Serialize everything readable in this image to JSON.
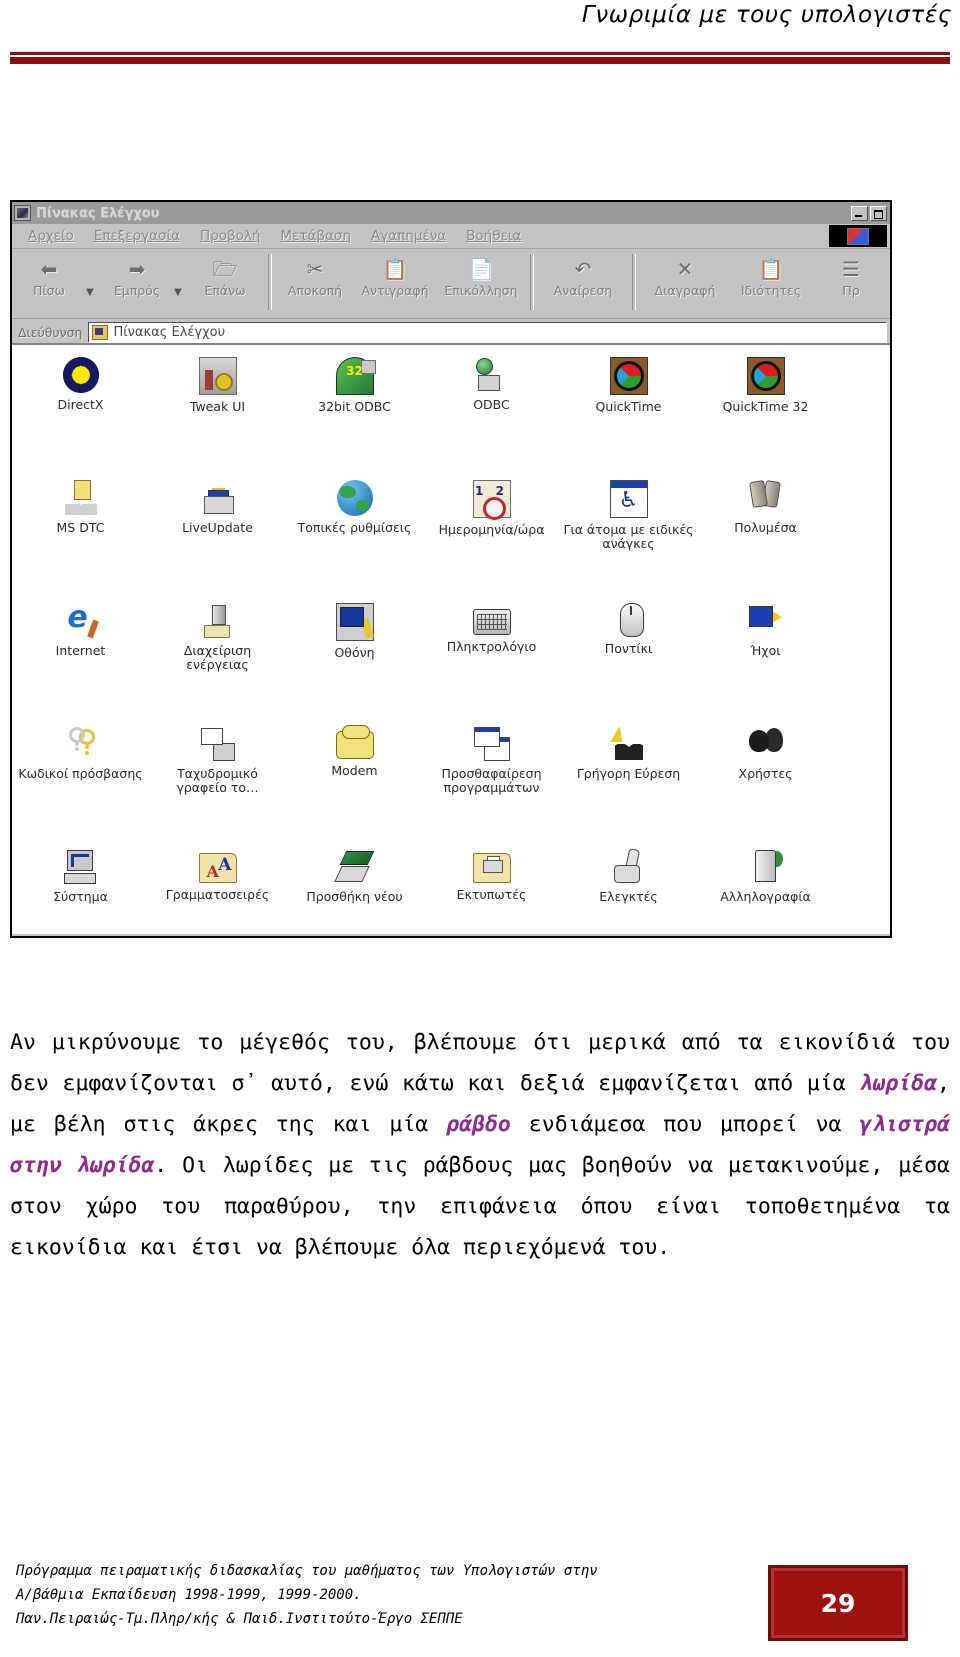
{
  "header": {
    "title": "Γνωριμία με τους υπολογιστές"
  },
  "window": {
    "title": "Πίνακας Ελέγχου",
    "title_icon": "control-panel-icon",
    "buttons": {
      "minimize": "minimize-icon",
      "maximize": "maximize-icon"
    },
    "menu": [
      {
        "label": "Αρχείο"
      },
      {
        "label": "Επεξεργασία"
      },
      {
        "label": "Προβολή"
      },
      {
        "label": "Μετάβαση"
      },
      {
        "label": "Αγαπημένα"
      },
      {
        "label": "Βοήθεια"
      }
    ],
    "toolbar": [
      {
        "label": "Πίσω",
        "icon": "back-arrow-icon"
      },
      {
        "label": "Εμπρός",
        "icon": "forward-arrow-icon"
      },
      {
        "label": "Επάνω",
        "icon": "up-folder-icon"
      },
      {
        "label": "Αποκοπή",
        "icon": "scissors-icon"
      },
      {
        "label": "Αντιγραφή",
        "icon": "copy-icon"
      },
      {
        "label": "Επικόλληση",
        "icon": "paste-icon"
      },
      {
        "label": "Αναίρεση",
        "icon": "undo-icon"
      },
      {
        "label": "Διαγραφή",
        "icon": "delete-x-icon"
      },
      {
        "label": "Ιδιότητες",
        "icon": "properties-icon"
      },
      {
        "label": "Πρ",
        "icon": "views-icon"
      }
    ],
    "address": {
      "label": "Διεύθυνση",
      "value": "Πίνακας Ελέγχου",
      "icon": "control-panel-folder-icon"
    },
    "items": [
      {
        "label": "DirectX",
        "icon": "directx-icon"
      },
      {
        "label": "Tweak UI",
        "icon": "tweak-ui-icon"
      },
      {
        "label": "32bit ODBC",
        "icon": "odbc32-icon"
      },
      {
        "label": "ODBC",
        "icon": "odbc-icon"
      },
      {
        "label": "QuickTime",
        "icon": "quicktime-icon"
      },
      {
        "label": "QuickTime 32",
        "icon": "quicktime32-icon"
      },
      {
        "label": "MS DTC",
        "icon": "msdtc-icon"
      },
      {
        "label": "LiveUpdate",
        "icon": "liveupdate-icon"
      },
      {
        "label": "Τοπικές ρυθμίσεις",
        "icon": "regional-settings-icon"
      },
      {
        "label": "Ημερομηνία/ώρα",
        "icon": "date-time-icon"
      },
      {
        "label": "Για άτομα με ειδικές ανάγκες",
        "icon": "accessibility-icon"
      },
      {
        "label": "Πολυμέσα",
        "icon": "multimedia-icon"
      },
      {
        "label": "Internet",
        "icon": "internet-icon"
      },
      {
        "label": "Διαχείριση ενέργειας",
        "icon": "power-management-icon"
      },
      {
        "label": "Οθόνη",
        "icon": "display-icon"
      },
      {
        "label": "Πληκτρολόγιο",
        "icon": "keyboard-icon"
      },
      {
        "label": "Ποντίκι",
        "icon": "mouse-icon"
      },
      {
        "label": "Ήχοι",
        "icon": "sounds-icon"
      },
      {
        "label": "Κωδικοί πρόσβασης",
        "icon": "passwords-icon"
      },
      {
        "label": "Ταχυδρομικό γραφείο το…",
        "icon": "mail-postoffice-icon"
      },
      {
        "label": "Modem",
        "icon": "modem-icon"
      },
      {
        "label": "Προσθαφαίρεση προγραμμάτων",
        "icon": "add-remove-programs-icon"
      },
      {
        "label": "Γρήγορη Εύρεση",
        "icon": "fast-find-icon"
      },
      {
        "label": "Χρήστες",
        "icon": "users-icon"
      },
      {
        "label": "Σύστημα",
        "icon": "system-icon"
      },
      {
        "label": "Γραμματοσειρές",
        "icon": "fonts-folder-icon"
      },
      {
        "label": "Προσθήκη νέου",
        "icon": "add-new-hardware-icon"
      },
      {
        "label": "Εκτυπωτές",
        "icon": "printers-folder-icon"
      },
      {
        "label": "Ελεγκτές",
        "icon": "game-controllers-icon"
      },
      {
        "label": "Αλληλογραφία",
        "icon": "mail-icon"
      }
    ]
  },
  "body": {
    "part1": "Αν μικρύνουμε το μέγεθός του, βλέπουμε ότι μερικά από τα εικονίδιά του δεν εμφανίζονται σ᾽ αυτό, ενώ κάτω και δεξιά εμφανίζεται από μία ",
    "term1": "λωρίδα",
    "part2": ", με βέλη στις άκρες της και μία ",
    "term2": "ράβδο",
    "part3": " ενδιάμεσα που μπορεί να ",
    "term3": "γλιστρά στην λωρίδα",
    "part4": ". Οι λωρίδες με τις ράβδους μας βοηθούν να μετακινούμε, μέσα στον χώρο του παραθύρου, την επιφάνεια όπου είναι τοποθετημένα τα εικονίδια και έτσι να βλέπουμε όλα περιεχόμενά του."
  },
  "footer": {
    "line1": "Πρόγραμμα πειραματικής διδασκαλίας του μαθήματος των Υπολογιστών στην",
    "line2": "Α/βάθμια Εκπαίδευση 1998-1999, 1999-2000.",
    "line3": "Παν.Πειραιώς-Τμ.Πληρ/κής & Παιδ.Ινστιτούτο-Έργο ΣΕΠΠΕ",
    "page_number": "29"
  },
  "colors": {
    "rule": "#8b1111",
    "term": "#8e2b8e",
    "page_box": "#9d1111"
  }
}
